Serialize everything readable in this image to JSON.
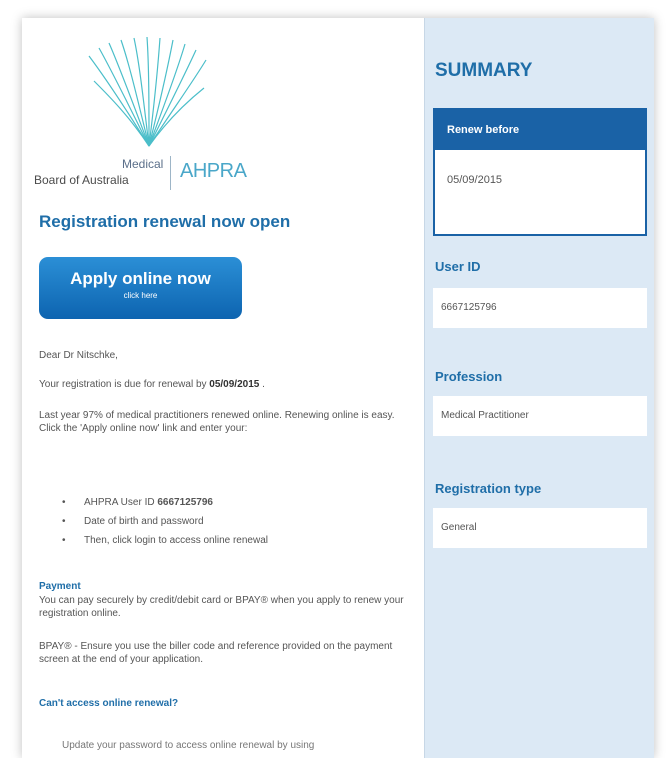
{
  "logo": {
    "line1": "Medical",
    "line2": "Board of Australia",
    "brand": "AHPRA"
  },
  "headline": "Registration renewal now open",
  "apply_button": {
    "label": "Apply online now",
    "sub": "click here"
  },
  "greeting": "Dear Dr Nitschke,",
  "due_text": "Your registration is due for renewal by ",
  "due_date": "05/09/2015",
  "due_suffix": " .",
  "intro": "Last year 97% of medical practitioners renewed online. Renewing online is easy. Click the 'Apply online now' link and enter your:",
  "bullets": [
    {
      "prefix": "AHPRA User ID ",
      "bold": "6667125796"
    },
    {
      "prefix": "Date of birth and password",
      "bold": ""
    },
    {
      "prefix": "Then, click login to access online renewal",
      "bold": ""
    }
  ],
  "payment": {
    "heading": "Payment",
    "text": "You can pay securely by credit/debit card or BPAY® when you apply to renew your registration online.",
    "bpay": "BPAY® - Ensure you use the biller code and reference provided on the payment screen at the end of your application."
  },
  "cant_access": "Can't access online renewal?",
  "cut_line": "Update your password to access online renewal by using",
  "summary": {
    "title": "SUMMARY",
    "renew_label": "Renew before",
    "renew_date": "05/09/2015",
    "user_id_label": "User ID",
    "user_id": "6667125796",
    "profession_label": "Profession",
    "profession": "Medical Practitioner",
    "reg_type_label": "Registration type",
    "reg_type": "General"
  },
  "colors": {
    "accent": "#1f6ea8",
    "button": "#0d64b0",
    "sidebar": "#dce9f5"
  }
}
